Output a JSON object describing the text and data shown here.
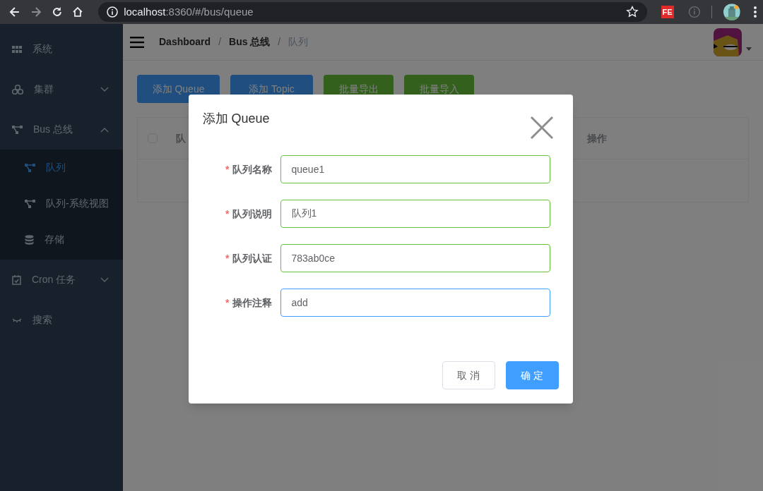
{
  "browser": {
    "url_host": "localhost",
    "url_path": ":8360/#/bus/queue",
    "extension_label": "FE"
  },
  "sidebar": {
    "items": [
      {
        "label": "系统",
        "kind": "grid",
        "selected": false
      },
      {
        "label": "集群",
        "kind": "cluster",
        "expanded": false,
        "selected": false
      },
      {
        "label": "Bus 总线",
        "kind": "nodes",
        "expanded": true,
        "selected": false,
        "children": [
          {
            "label": "队列",
            "kind": "nodes",
            "selected": true
          },
          {
            "label": "队列-系统视图",
            "kind": "nodes",
            "selected": false
          },
          {
            "label": "存储",
            "kind": "database",
            "selected": false
          }
        ]
      },
      {
        "label": "Cron 任务",
        "kind": "calendar",
        "expanded": false,
        "selected": false
      },
      {
        "label": "搜索",
        "kind": "eye",
        "selected": false
      }
    ]
  },
  "header": {
    "separator": "/",
    "breadcrumbs": [
      {
        "label": "Dashboard",
        "current": false
      },
      {
        "label": "Bus 总线",
        "current": false
      },
      {
        "label": "队列",
        "current": true
      }
    ]
  },
  "toolbar": [
    {
      "label": "添加 Queue",
      "kind": "primary"
    },
    {
      "label": "添加 Topic",
      "kind": "primary"
    },
    {
      "label": "批量导出",
      "kind": "success"
    },
    {
      "label": "批量导入",
      "kind": "success"
    }
  ],
  "table": {
    "select_all_checked": false,
    "columns": [
      "队",
      "操作"
    ]
  },
  "dialog": {
    "title": "添加 Queue",
    "required_mark": "*",
    "fields": [
      {
        "label": "队列名称",
        "value": "queue1",
        "focused": false
      },
      {
        "label": "队列说明",
        "value": "队列1",
        "focused": false
      },
      {
        "label": "队列认证",
        "value": "783ab0ce",
        "focused": false
      },
      {
        "label": "操作注释",
        "value": "add",
        "focused": true
      }
    ],
    "buttons": [
      {
        "label": "取 消",
        "kind": "default"
      },
      {
        "label": "确 定",
        "kind": "primary"
      }
    ]
  }
}
